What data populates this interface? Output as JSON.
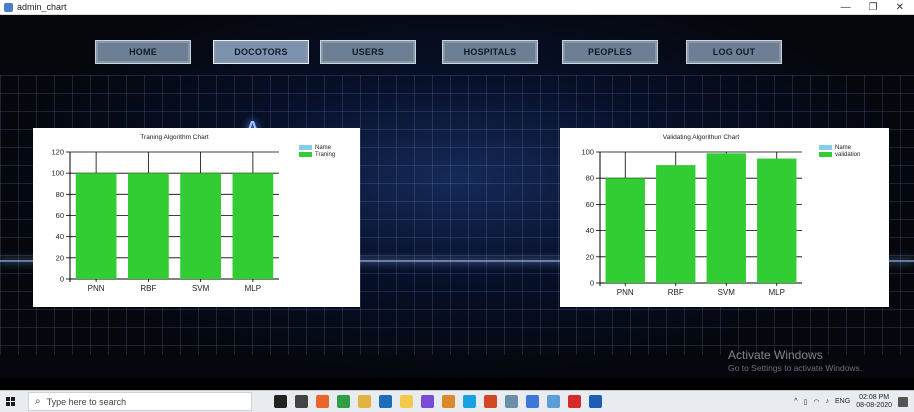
{
  "window": {
    "title": "admin_chart",
    "controls": [
      "—",
      "❐",
      "✕"
    ]
  },
  "nav": {
    "items": [
      {
        "label": "HOME"
      },
      {
        "label": "DOCOTORS",
        "active": true
      },
      {
        "label": "USERS"
      },
      {
        "label": "HOSPITALS"
      },
      {
        "label": "PEOPLES"
      },
      {
        "label": "LOG OUT"
      }
    ]
  },
  "logo_letter": "A",
  "charts": {
    "training": {
      "title": "Traning Algorithm Chart",
      "legend": [
        {
          "label": "Name",
          "color": "#87ceeb"
        },
        {
          "label": "Traning",
          "color": "#32cd32"
        }
      ]
    },
    "validating": {
      "title": "Validating Algorithun Chart",
      "legend": [
        {
          "label": "Name",
          "color": "#87ceeb"
        },
        {
          "label": "validation",
          "color": "#32cd32"
        }
      ]
    }
  },
  "chart_data": [
    {
      "type": "bar",
      "title": "Traning Algorithm Chart",
      "categories": [
        "PNN",
        "RBF",
        "SVM",
        "MLP"
      ],
      "series": [
        {
          "name": "Traning",
          "values": [
            100,
            100,
            100,
            100
          ],
          "color": "#32cd32"
        }
      ],
      "ylim": [
        0,
        120
      ],
      "yticks": [
        0,
        20,
        40,
        60,
        80,
        100,
        120
      ],
      "grid": true,
      "legend_position": "top-right"
    },
    {
      "type": "bar",
      "title": "Validating Algorithun Chart",
      "categories": [
        "PNN",
        "RBF",
        "SVM",
        "MLP"
      ],
      "series": [
        {
          "name": "validation",
          "values": [
            80,
            90,
            99,
            95
          ],
          "color": "#32cd32"
        }
      ],
      "ylim": [
        0,
        100
      ],
      "yticks": [
        0,
        20,
        40,
        60,
        80,
        100
      ],
      "grid": true,
      "legend_position": "top-right"
    }
  ],
  "watermark": {
    "line1": "Activate Windows",
    "line2": "Go to Settings to activate Windows."
  },
  "taskbar": {
    "search_placeholder": "Type here to search",
    "icons": [
      {
        "name": "cortana-icon",
        "color": "#222222"
      },
      {
        "name": "task-view-icon",
        "color": "#444444"
      },
      {
        "name": "firefox-icon",
        "color": "#e8662a"
      },
      {
        "name": "chrome-icon",
        "color": "#2f9e44"
      },
      {
        "name": "file-explorer-icon",
        "color": "#e3b341"
      },
      {
        "name": "edge-icon",
        "color": "#1a6fb8"
      },
      {
        "name": "sticky-notes-icon",
        "color": "#f2c94c"
      },
      {
        "name": "visual-studio-icon",
        "color": "#7b4bd6"
      },
      {
        "name": "app-icon",
        "color": "#d98b2b"
      },
      {
        "name": "skype-icon",
        "color": "#1aa1e0"
      },
      {
        "name": "powerpoint-icon",
        "color": "#d24726"
      },
      {
        "name": "paint-icon",
        "color": "#6a8ea8"
      },
      {
        "name": "link-icon",
        "color": "#3c78d8"
      },
      {
        "name": "tools-icon",
        "color": "#5aa0d6"
      },
      {
        "name": "acrobat-icon",
        "color": "#d62b2b"
      },
      {
        "name": "active-window-icon",
        "color": "#1a5fb4"
      }
    ],
    "tray": {
      "language": "ENG",
      "time": "02:08 PM",
      "date": "08-08-2020"
    }
  }
}
